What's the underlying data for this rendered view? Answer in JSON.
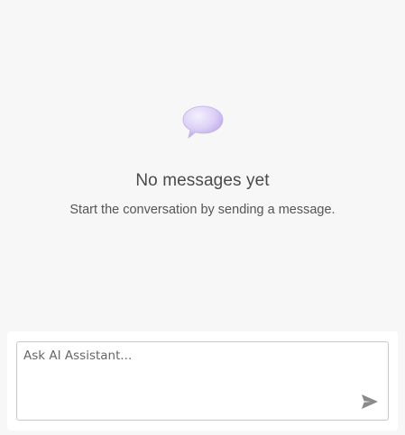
{
  "empty_state": {
    "icon": "speech-bubble-icon",
    "title": "No messages yet",
    "subtitle": "Start the conversation by sending a message."
  },
  "composer": {
    "placeholder": "Ask AI Assistant...",
    "value": "",
    "send_icon": "send-icon"
  },
  "colors": {
    "background": "#f7f7f7",
    "bubble_light": "#eee8fb",
    "bubble_dark": "#c7b5ea",
    "send_icon": "#8a8a8a"
  }
}
